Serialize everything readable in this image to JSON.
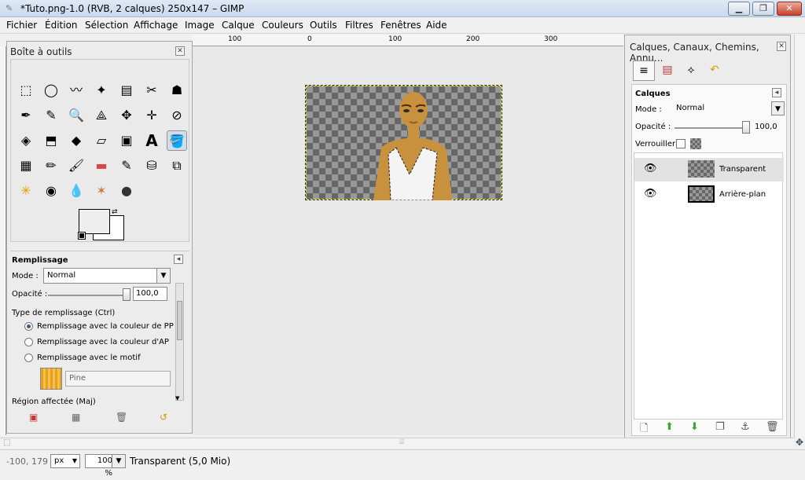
{
  "window": {
    "title": "*Tuto.png-1.0 (RVB, 2 calques) 250x147 – GIMP",
    "minimize": "▁",
    "maximize": "❐",
    "close": "✕"
  },
  "menu": [
    "Fichier",
    "Édition",
    "Sélection",
    "Affichage",
    "Image",
    "Calque",
    "Couleurs",
    "Outils",
    "Filtres",
    "Fenêtres",
    "Aide"
  ],
  "ruler": {
    "labels": [
      "100",
      "0",
      "100",
      "200",
      "300"
    ]
  },
  "toolbox": {
    "title": "Boîte à outils",
    "tools": [
      "⬚",
      "◯",
      "〰",
      "✦",
      "▤",
      "✂",
      "☗",
      "✒",
      "✎",
      "🔍",
      "⟁",
      "✥",
      "✛",
      "⊘",
      "◈",
      "⬒",
      "◆",
      "▱",
      "▣",
      "A",
      "🪣",
      "▦",
      "✏",
      "🖌",
      "▬",
      "✎",
      "⛁",
      "⧉",
      "✳",
      "◉",
      "💧",
      "✶",
      "●"
    ],
    "tool_options": {
      "title": "Remplissage",
      "mode_label": "Mode :",
      "mode_value": "Normal",
      "opacity_label": "Opacité :",
      "opacity_value": "100,0",
      "opacity_fraction": 1.0,
      "fill_type_label": "Type de remplissage  (Ctrl)",
      "options": [
        "Remplissage avec la couleur de PP",
        "Remplissage avec la couleur d'AP",
        "Remplissage avec le motif"
      ],
      "pattern_name": "Pine",
      "affected_label": "Région affectée  (Maj)"
    }
  },
  "layers_panel": {
    "title": "Calques, Canaux, Chemins, Annu...",
    "section_title": "Calques",
    "mode_label": "Mode :",
    "mode_value": "Normal",
    "opacity_label": "Opacité :",
    "opacity_value": "100,0",
    "lock_label": "Verrouiller :",
    "layers": [
      {
        "name": "Transparent",
        "selected": true
      },
      {
        "name": "Arrière-plan",
        "selected": false
      }
    ]
  },
  "status": {
    "coords": "-100, 179",
    "unit": "px",
    "zoom": "100 %",
    "message": "Transparent (5,0 Mio)"
  },
  "colors": {
    "fg": "#000000",
    "bg": "#ffffff",
    "selection": "#e8e800"
  }
}
